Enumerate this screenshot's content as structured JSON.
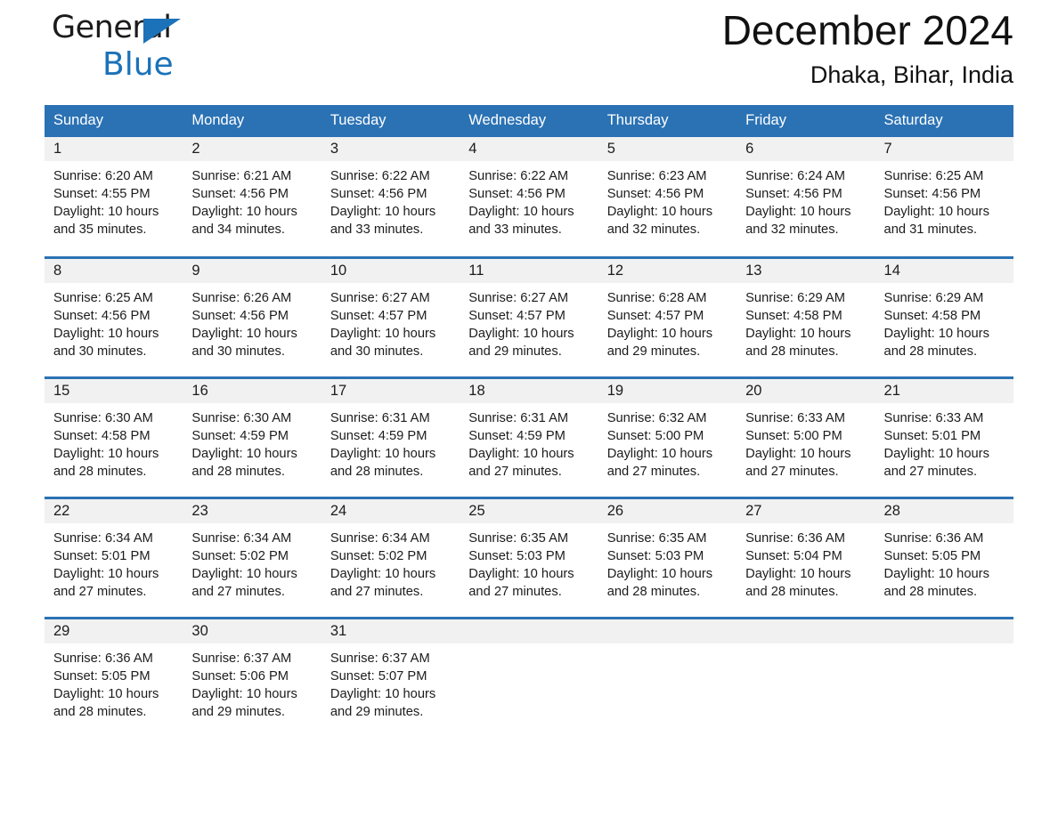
{
  "brand": {
    "line1": "General",
    "line2": "Blue",
    "triangle_color": "#1b72b8"
  },
  "header": {
    "month_title": "December 2024",
    "location": "Dhaka, Bihar, India",
    "header_bg": "#2b72b4",
    "row_divider_color": "#2b72b4",
    "daynum_bg": "#f1f1f1"
  },
  "weekday_headers": [
    "Sunday",
    "Monday",
    "Tuesday",
    "Wednesday",
    "Thursday",
    "Friday",
    "Saturday"
  ],
  "weeks": [
    [
      {
        "day": "1",
        "sunrise": "Sunrise: 6:20 AM",
        "sunset": "Sunset: 4:55 PM",
        "daylight1": "Daylight: 10 hours",
        "daylight2": "and 35 minutes."
      },
      {
        "day": "2",
        "sunrise": "Sunrise: 6:21 AM",
        "sunset": "Sunset: 4:56 PM",
        "daylight1": "Daylight: 10 hours",
        "daylight2": "and 34 minutes."
      },
      {
        "day": "3",
        "sunrise": "Sunrise: 6:22 AM",
        "sunset": "Sunset: 4:56 PM",
        "daylight1": "Daylight: 10 hours",
        "daylight2": "and 33 minutes."
      },
      {
        "day": "4",
        "sunrise": "Sunrise: 6:22 AM",
        "sunset": "Sunset: 4:56 PM",
        "daylight1": "Daylight: 10 hours",
        "daylight2": "and 33 minutes."
      },
      {
        "day": "5",
        "sunrise": "Sunrise: 6:23 AM",
        "sunset": "Sunset: 4:56 PM",
        "daylight1": "Daylight: 10 hours",
        "daylight2": "and 32 minutes."
      },
      {
        "day": "6",
        "sunrise": "Sunrise: 6:24 AM",
        "sunset": "Sunset: 4:56 PM",
        "daylight1": "Daylight: 10 hours",
        "daylight2": "and 32 minutes."
      },
      {
        "day": "7",
        "sunrise": "Sunrise: 6:25 AM",
        "sunset": "Sunset: 4:56 PM",
        "daylight1": "Daylight: 10 hours",
        "daylight2": "and 31 minutes."
      }
    ],
    [
      {
        "day": "8",
        "sunrise": "Sunrise: 6:25 AM",
        "sunset": "Sunset: 4:56 PM",
        "daylight1": "Daylight: 10 hours",
        "daylight2": "and 30 minutes."
      },
      {
        "day": "9",
        "sunrise": "Sunrise: 6:26 AM",
        "sunset": "Sunset: 4:56 PM",
        "daylight1": "Daylight: 10 hours",
        "daylight2": "and 30 minutes."
      },
      {
        "day": "10",
        "sunrise": "Sunrise: 6:27 AM",
        "sunset": "Sunset: 4:57 PM",
        "daylight1": "Daylight: 10 hours",
        "daylight2": "and 30 minutes."
      },
      {
        "day": "11",
        "sunrise": "Sunrise: 6:27 AM",
        "sunset": "Sunset: 4:57 PM",
        "daylight1": "Daylight: 10 hours",
        "daylight2": "and 29 minutes."
      },
      {
        "day": "12",
        "sunrise": "Sunrise: 6:28 AM",
        "sunset": "Sunset: 4:57 PM",
        "daylight1": "Daylight: 10 hours",
        "daylight2": "and 29 minutes."
      },
      {
        "day": "13",
        "sunrise": "Sunrise: 6:29 AM",
        "sunset": "Sunset: 4:58 PM",
        "daylight1": "Daylight: 10 hours",
        "daylight2": "and 28 minutes."
      },
      {
        "day": "14",
        "sunrise": "Sunrise: 6:29 AM",
        "sunset": "Sunset: 4:58 PM",
        "daylight1": "Daylight: 10 hours",
        "daylight2": "and 28 minutes."
      }
    ],
    [
      {
        "day": "15",
        "sunrise": "Sunrise: 6:30 AM",
        "sunset": "Sunset: 4:58 PM",
        "daylight1": "Daylight: 10 hours",
        "daylight2": "and 28 minutes."
      },
      {
        "day": "16",
        "sunrise": "Sunrise: 6:30 AM",
        "sunset": "Sunset: 4:59 PM",
        "daylight1": "Daylight: 10 hours",
        "daylight2": "and 28 minutes."
      },
      {
        "day": "17",
        "sunrise": "Sunrise: 6:31 AM",
        "sunset": "Sunset: 4:59 PM",
        "daylight1": "Daylight: 10 hours",
        "daylight2": "and 28 minutes."
      },
      {
        "day": "18",
        "sunrise": "Sunrise: 6:31 AM",
        "sunset": "Sunset: 4:59 PM",
        "daylight1": "Daylight: 10 hours",
        "daylight2": "and 27 minutes."
      },
      {
        "day": "19",
        "sunrise": "Sunrise: 6:32 AM",
        "sunset": "Sunset: 5:00 PM",
        "daylight1": "Daylight: 10 hours",
        "daylight2": "and 27 minutes."
      },
      {
        "day": "20",
        "sunrise": "Sunrise: 6:33 AM",
        "sunset": "Sunset: 5:00 PM",
        "daylight1": "Daylight: 10 hours",
        "daylight2": "and 27 minutes."
      },
      {
        "day": "21",
        "sunrise": "Sunrise: 6:33 AM",
        "sunset": "Sunset: 5:01 PM",
        "daylight1": "Daylight: 10 hours",
        "daylight2": "and 27 minutes."
      }
    ],
    [
      {
        "day": "22",
        "sunrise": "Sunrise: 6:34 AM",
        "sunset": "Sunset: 5:01 PM",
        "daylight1": "Daylight: 10 hours",
        "daylight2": "and 27 minutes."
      },
      {
        "day": "23",
        "sunrise": "Sunrise: 6:34 AM",
        "sunset": "Sunset: 5:02 PM",
        "daylight1": "Daylight: 10 hours",
        "daylight2": "and 27 minutes."
      },
      {
        "day": "24",
        "sunrise": "Sunrise: 6:34 AM",
        "sunset": "Sunset: 5:02 PM",
        "daylight1": "Daylight: 10 hours",
        "daylight2": "and 27 minutes."
      },
      {
        "day": "25",
        "sunrise": "Sunrise: 6:35 AM",
        "sunset": "Sunset: 5:03 PM",
        "daylight1": "Daylight: 10 hours",
        "daylight2": "and 27 minutes."
      },
      {
        "day": "26",
        "sunrise": "Sunrise: 6:35 AM",
        "sunset": "Sunset: 5:03 PM",
        "daylight1": "Daylight: 10 hours",
        "daylight2": "and 28 minutes."
      },
      {
        "day": "27",
        "sunrise": "Sunrise: 6:36 AM",
        "sunset": "Sunset: 5:04 PM",
        "daylight1": "Daylight: 10 hours",
        "daylight2": "and 28 minutes."
      },
      {
        "day": "28",
        "sunrise": "Sunrise: 6:36 AM",
        "sunset": "Sunset: 5:05 PM",
        "daylight1": "Daylight: 10 hours",
        "daylight2": "and 28 minutes."
      }
    ],
    [
      {
        "day": "29",
        "sunrise": "Sunrise: 6:36 AM",
        "sunset": "Sunset: 5:05 PM",
        "daylight1": "Daylight: 10 hours",
        "daylight2": "and 28 minutes."
      },
      {
        "day": "30",
        "sunrise": "Sunrise: 6:37 AM",
        "sunset": "Sunset: 5:06 PM",
        "daylight1": "Daylight: 10 hours",
        "daylight2": "and 29 minutes."
      },
      {
        "day": "31",
        "sunrise": "Sunrise: 6:37 AM",
        "sunset": "Sunset: 5:07 PM",
        "daylight1": "Daylight: 10 hours",
        "daylight2": "and 29 minutes."
      },
      {
        "day": "",
        "sunrise": "",
        "sunset": "",
        "daylight1": "",
        "daylight2": ""
      },
      {
        "day": "",
        "sunrise": "",
        "sunset": "",
        "daylight1": "",
        "daylight2": ""
      },
      {
        "day": "",
        "sunrise": "",
        "sunset": "",
        "daylight1": "",
        "daylight2": ""
      },
      {
        "day": "",
        "sunrise": "",
        "sunset": "",
        "daylight1": "",
        "daylight2": ""
      }
    ]
  ]
}
